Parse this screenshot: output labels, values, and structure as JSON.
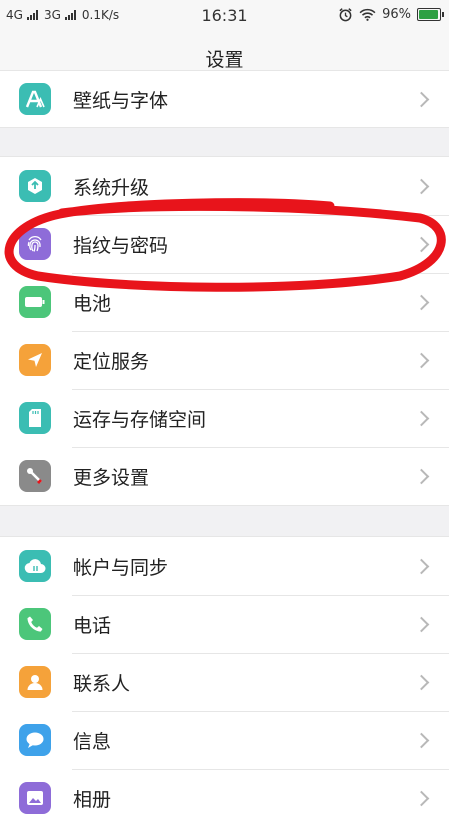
{
  "status_bar": {
    "network1": "4G",
    "network2": "3G",
    "speed": "0.1K/s",
    "time": "16:31",
    "battery_text": "96%",
    "battery_level": 0.96
  },
  "header": {
    "title": "设置"
  },
  "group_top": [
    {
      "label": "壁纸与字体",
      "icon": "font-a-icon",
      "color": "#3bbdb3"
    }
  ],
  "group_system": [
    {
      "label": "系统升级",
      "icon": "upgrade-box-icon",
      "color": "#3bbdb3"
    },
    {
      "label": "指纹与密码",
      "icon": "fingerprint-icon",
      "color": "#8e6cd8"
    },
    {
      "label": "电池",
      "icon": "battery-icon",
      "color": "#4cc67a"
    },
    {
      "label": "定位服务",
      "icon": "location-arrow-icon",
      "color": "#f5a23a"
    },
    {
      "label": "运存与存储空间",
      "icon": "sd-card-icon",
      "color": "#3bbdb3"
    },
    {
      "label": "更多设置",
      "icon": "tools-icon",
      "color": "#8a8a8a"
    }
  ],
  "group_apps": [
    {
      "label": "帐户与同步",
      "icon": "cloud-sync-icon",
      "color": "#3bbdb3"
    },
    {
      "label": "电话",
      "icon": "phone-icon",
      "color": "#4cc67a"
    },
    {
      "label": "联系人",
      "icon": "contacts-icon",
      "color": "#f5a23a"
    },
    {
      "label": "信息",
      "icon": "message-icon",
      "color": "#3ea2ea"
    },
    {
      "label": "相册",
      "icon": "album-icon",
      "color": "#8e6cd8"
    }
  ],
  "annotation": {
    "color": "#e8141b"
  }
}
